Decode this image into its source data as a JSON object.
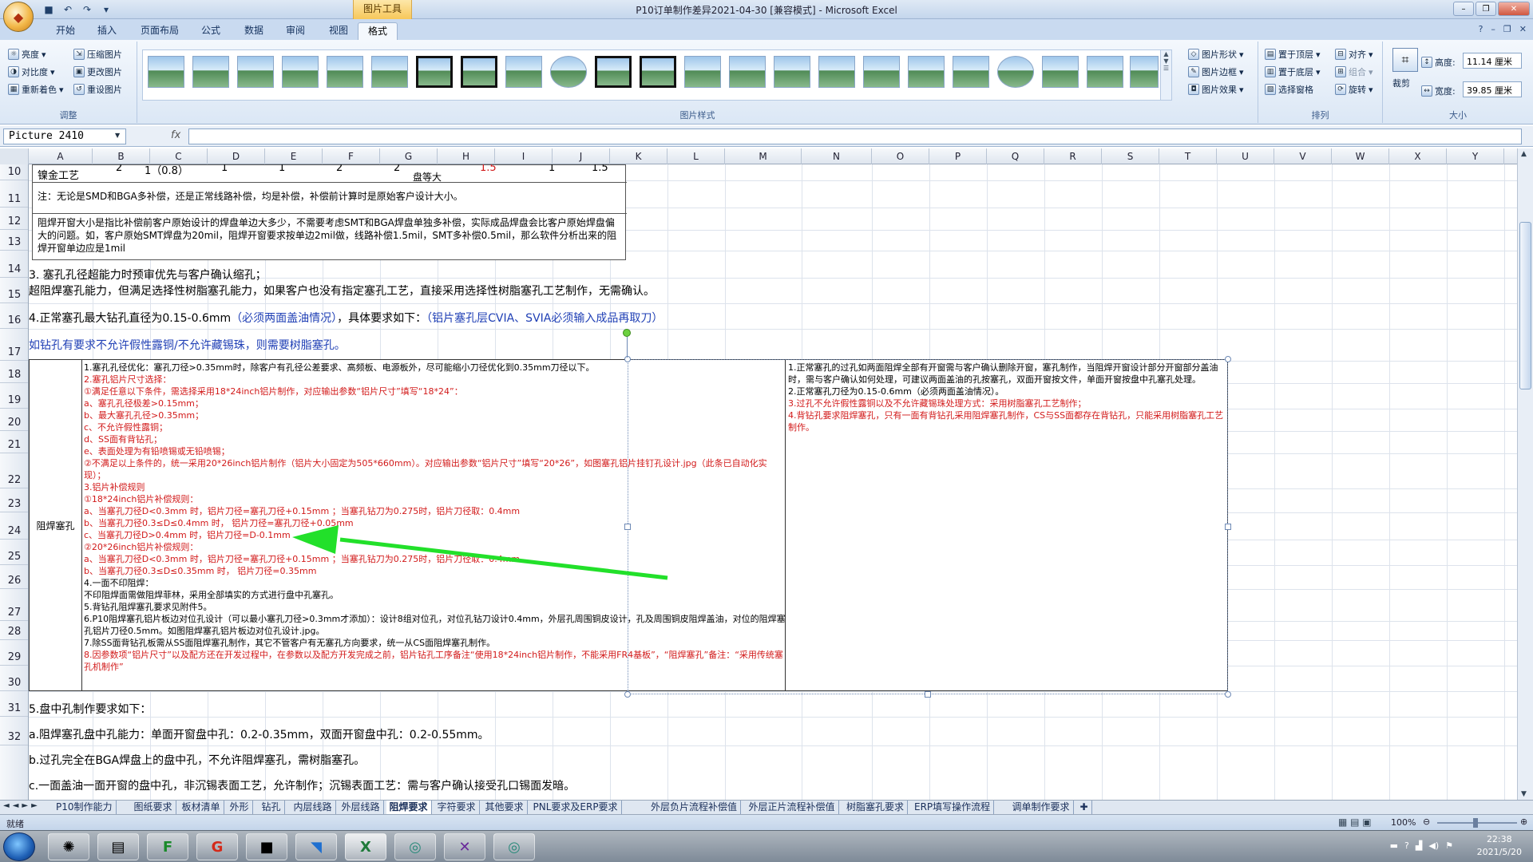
{
  "window": {
    "title": "P10订单制作差异2021-04-30  [兼容模式] - Microsoft Excel",
    "tool_context": "图片工具",
    "office_button_icon": "office-logo-icon"
  },
  "tabs": [
    "开始",
    "插入",
    "页面布局",
    "公式",
    "数据",
    "审阅",
    "视图",
    "格式"
  ],
  "active_tab": "格式",
  "ribbon": {
    "adjust": {
      "label": "调整",
      "items": [
        "亮度",
        "对比度",
        "重新着色",
        "压缩图片",
        "更改图片",
        "重设图片"
      ]
    },
    "styles": {
      "label": "图片样式",
      "right_items": [
        "图片形状",
        "图片边框",
        "图片效果"
      ]
    },
    "arrange": {
      "label": "排列",
      "items": [
        "置于顶层",
        "置于底层",
        "选择窗格",
        "对齐",
        "组合",
        "旋转"
      ]
    },
    "size": {
      "label": "大小",
      "crop": "裁剪",
      "height_label": "高度:",
      "height_value": "11.14 厘米",
      "width_label": "宽度:",
      "width_value": "39.85 厘米"
    }
  },
  "formula_bar": {
    "name_box": "Picture 2410",
    "fx": "fx",
    "value": ""
  },
  "columns": [
    "A",
    "B",
    "C",
    "D",
    "E",
    "F",
    "G",
    "H",
    "I",
    "J",
    "K",
    "L",
    "M",
    "N",
    "O",
    "P",
    "Q",
    "R",
    "S",
    "T",
    "U",
    "V",
    "W",
    "X",
    "Y"
  ],
  "rows": [
    "10",
    "11",
    "12",
    "13",
    "14",
    "15",
    "16",
    "17",
    "18",
    "19",
    "20",
    "21",
    "22",
    "23",
    "24",
    "25",
    "26",
    "27",
    "28",
    "29",
    "30",
    "31",
    "32"
  ],
  "table_top": {
    "row10": [
      "镍金工艺",
      "2",
      "1（0.8）",
      "1",
      "1",
      "2",
      "2",
      "盘等大",
      "1.5",
      "1",
      "1.5"
    ],
    "note11": "注：无论是SMD和BGA多补偿，还是正常线路补偿，均是补偿，补偿前计算时是原始客户设计大小。",
    "note12": "阻焊开窗大小是指比补偿前客户原始设计的焊盘单边大多少，不需要考虑SMT和BGA焊盘单独多补偿，实际成品焊盘会比客户原始焊盘偏大的问题。如，客户原始SMT焊盘为20mil，阻焊开窗要求按单边2mil做，线路补偿1.5mil，SMT多补偿0.5mil，那么软件分析出来的阻焊开窗单边应是1mil"
  },
  "lines": {
    "l14a": "3. 塞孔孔径超能力时预审优先与客户确认缩孔；",
    "l14b": "超阻焊塞孔能力，但满足选择性树脂塞孔能力，如果客户也没有指定塞孔工艺，直接采用选择性树脂塞孔工艺制作，无需确认。",
    "l15a": "4.正常塞孔最大钻孔直径为0.15-0.6mm",
    "l15b": "（必须两面盖油情况）",
    "l15c": "，具体要求如下：",
    "l15d": "（铝片塞孔层CVIA、SVIA必须输入成品再取刀）",
    "l16": "如钻孔有要求不允许假性露铜/不允许藏锡珠，则需要树脂塞孔。",
    "l29": "5.盘中孔制作要求如下：",
    "l30": "a.阻焊塞孔盘中孔能力：单面开窗盘中孔：0.2-0.35mm，双面开窗盘中孔：0.2-0.55mm。",
    "l31": "b.过孔完全在BGA焊盘上的盘中孔，不允许阻焊塞孔，需树脂塞孔。",
    "l32": "c.一面盖油一面开窗的盘中孔，非沉锡表面工艺，允许制作；沉锡表面工艺：需与客户确认接受孔口锡面发暗。"
  },
  "block": {
    "label": "阻焊塞孔",
    "left_lines": [
      {
        "t": "1.塞孔孔径优化：塞孔刀径>0.35mm时，除客户有孔径公差要求、高频板、电源板外，尽可能缩小刀径优化到0.35mm刀径以下。",
        "c": "k"
      },
      {
        "t": "2.塞孔铝片尺寸选择：",
        "c": "r"
      },
      {
        "t": "①满足任意以下条件，需选择采用18*24inch铝片制作，对应输出参数“铝片尺寸”填写“18*24”：",
        "c": "r"
      },
      {
        "t": "a、塞孔孔径极差>0.15mm；",
        "c": "r"
      },
      {
        "t": "b、最大塞孔孔径>0.35mm；",
        "c": "r"
      },
      {
        "t": "c、不允许假性露铜；",
        "c": "r"
      },
      {
        "t": "d、SS面有背钻孔；",
        "c": "r"
      },
      {
        "t": "e、表面处理为有铅喷锡或无铅喷锡；",
        "c": "r"
      },
      {
        "t": "②不满足以上条件的，统一采用20*26inch铝片制作（铝片大小固定为505*660mm）。对应输出参数“铝片尺寸”填写“20*26”，如图塞孔铝片挂钉孔设计.jpg（此条已自动化实现）；",
        "c": "r"
      },
      {
        "t": "3.铝片补偿规则",
        "c": "r"
      },
      {
        "t": "①18*24inch铝片补偿规则：",
        "c": "r"
      },
      {
        "t": "a、当塞孔刀径D<0.3mm 时，铝片刀径=塞孔刀径+0.15mm ；当塞孔钻刀为0.275时，铝片刀径取：0.4mm",
        "c": "r"
      },
      {
        "t": "b、当塞孔刀径0.3≤D≤0.4mm 时， 铝片刀径=塞孔刀径+0.05mm",
        "c": "r"
      },
      {
        "t": "c、当塞孔刀径D>0.4mm 时，铝片刀径=D-0.1mm",
        "c": "r"
      },
      {
        "t": "②20*26inch铝片补偿规则：",
        "c": "r"
      },
      {
        "t": "a、当塞孔刀径D<0.3mm 时，铝片刀径=塞孔刀径+0.15mm ；当塞孔钻刀为0.275时，铝片刀径取：0.4mm",
        "c": "r"
      },
      {
        "t": "b、当塞孔刀径0.3≤D≤0.35mm 时， 铝片刀径=0.35mm",
        "c": "r"
      },
      {
        "t": "4.一面不印阻焊：",
        "c": "k"
      },
      {
        "t": "不印阻焊面需做阻焊菲林，采用全部填实的方式进行盘中孔塞孔。",
        "c": "k"
      },
      {
        "t": "5.背钻孔阻焊塞孔要求见附件5。",
        "c": "k"
      },
      {
        "t": "6.P10阻焊塞孔铝片板边对位孔设计（可以最小塞孔刀径>0.3mm才添加）：设计8组对位孔，对位孔钻刀设计0.4mm，外层孔周围铜皮设计，孔及周围铜皮阻焊盖油，对位的阻焊塞孔铝片刀径0.5mm。如图阻焊塞孔铝片板边对位孔设计.jpg。",
        "c": "k"
      },
      {
        "t": "7.除SS面背钻孔板需从SS面阻焊塞孔制作，其它不管客户有无塞孔方向要求，统一从CS面阻焊塞孔制作。",
        "c": "k"
      },
      {
        "t": "8.因参数项“铝片尺寸”以及配方还在开发过程中，在参数以及配方开发完成之前，铝片钻孔工序备注“使用18*24inch铝片制作，不能采用FR4基板”，“阻焊塞孔”备注：“采用传统塞孔机制作”",
        "c": "r"
      }
    ],
    "right_lines": [
      {
        "t": "1.正常塞孔的过孔如两面阻焊全部有开窗需与客户确认删除开窗，塞孔制作，当阻焊开窗设计部分开窗部分盖油时，需与客户确认如何处理，可建议两面盖油的孔按塞孔，双面开窗按文件，单面开窗按盘中孔塞孔处理。",
        "c": "k"
      },
      {
        "t": "2.正常塞孔刀径为0.15-0.6mm（必须两面盖油情况）。",
        "c": "k"
      },
      {
        "t": "3.过孔不允许假性露铜以及不允许藏锡珠处理方式：采用树脂塞孔工艺制作；",
        "c": "r"
      },
      {
        "t": "4.背钻孔要求阻焊塞孔，只有一面有背钻孔采用阻焊塞孔制作，CS与SS面都存在背钻孔，只能采用树脂塞孔工艺制作。",
        "c": "r"
      }
    ]
  },
  "sheet_tabs": [
    "P10制作能力",
    "图纸要求",
    "板材清单",
    "外形",
    "钻孔",
    "内层线路",
    "外层线路",
    "阻焊要求",
    "字符要求",
    "其他要求",
    "PNL要求及ERP要求",
    "外层负片流程补偿值",
    "外层正片流程补偿值",
    "树脂塞孔要求",
    "ERP填写操作流程",
    "调单制作要求"
  ],
  "active_sheet": "阻焊要求",
  "status": {
    "left": "就绪",
    "zoom": "100%"
  },
  "taskbar": {
    "time": "22:38",
    "date": "2021/5/20"
  },
  "colors": {
    "red": "#d21a1a",
    "blue": "#1f3fb5",
    "arrow": "#22e02a"
  }
}
